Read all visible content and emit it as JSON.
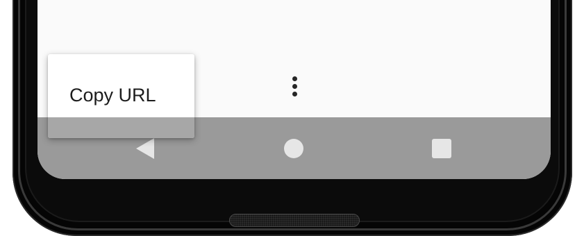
{
  "popup_menu": {
    "items": [
      {
        "label": "Copy URL"
      }
    ]
  },
  "toolbar": {
    "overflow_icon": "more-vert-icon"
  },
  "nav_bar": {
    "back_icon": "back-triangle-icon",
    "home_icon": "home-circle-icon",
    "recents_icon": "recents-square-icon"
  },
  "colors": {
    "screen_background": "#fafafa",
    "nav_bar": "#9a9a9a",
    "nav_icons": "#e6e6e6",
    "menu_background": "#ffffff",
    "text": "#1c1c1c",
    "device_frame": "#050505"
  }
}
